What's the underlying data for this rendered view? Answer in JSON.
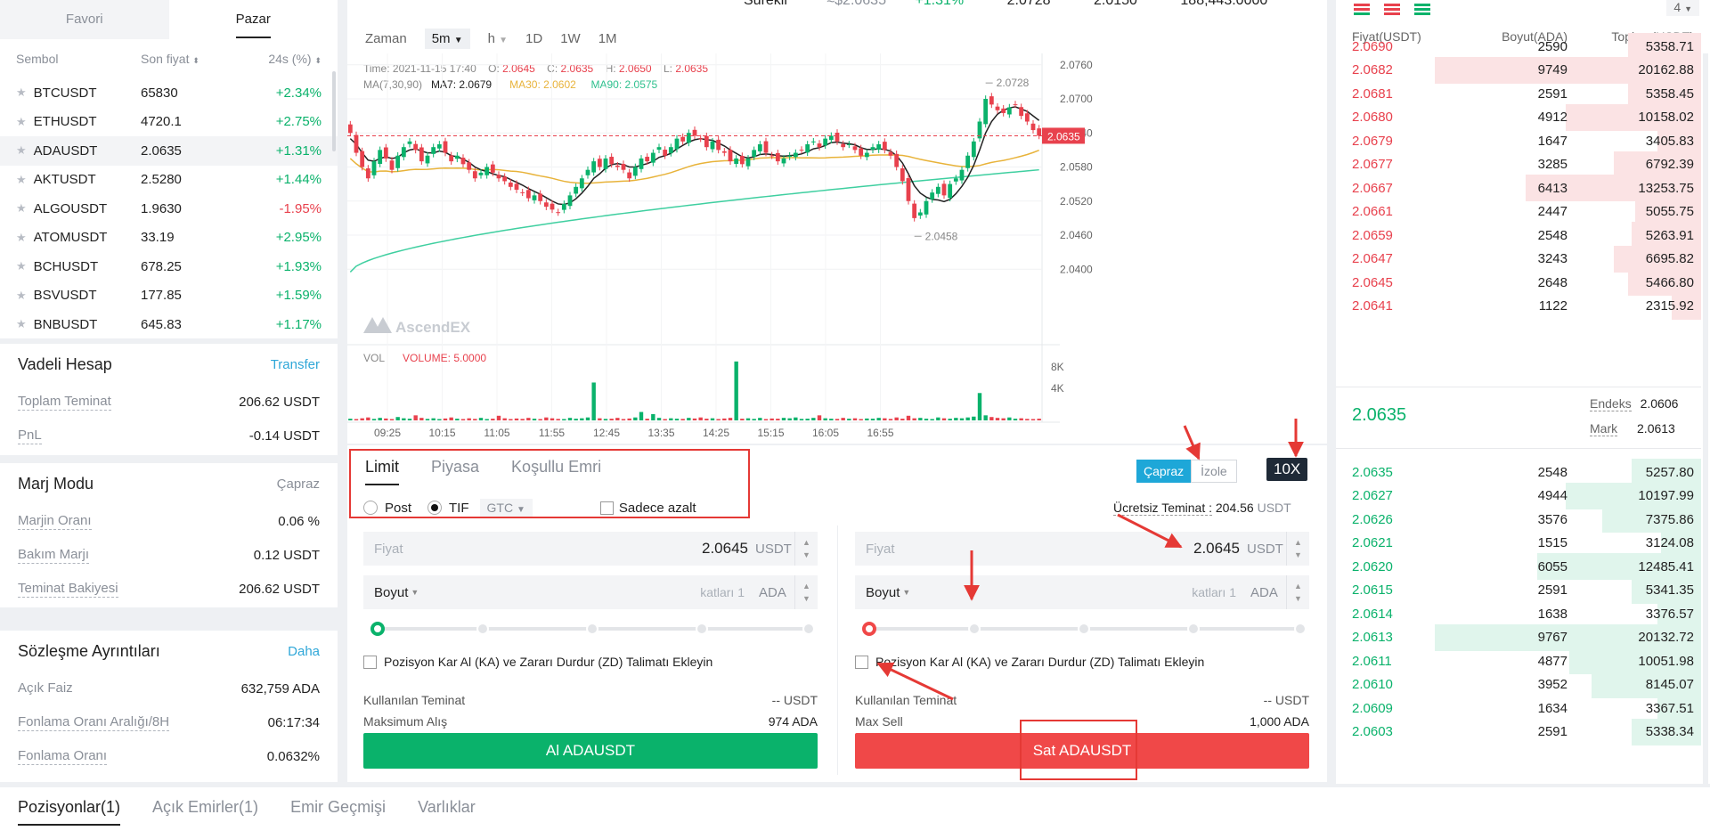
{
  "left": {
    "tabs": [
      "Favori",
      "Pazar"
    ],
    "columns": [
      "Sembol",
      "Son fiyat",
      "24s (%)"
    ],
    "markets": [
      {
        "symbol": "BTCUSDT",
        "price": "65830",
        "change": "+2.34%",
        "dir": "up"
      },
      {
        "symbol": "ETHUSDT",
        "price": "4720.1",
        "change": "+2.75%",
        "dir": "up"
      },
      {
        "symbol": "ADAUSDT",
        "price": "2.0635",
        "change": "+1.31%",
        "dir": "up"
      },
      {
        "symbol": "AKTUSDT",
        "price": "2.5280",
        "change": "+1.44%",
        "dir": "up"
      },
      {
        "symbol": "ALGOUSDT",
        "price": "1.9630",
        "change": "-1.95%",
        "dir": "down"
      },
      {
        "symbol": "ATOMUSDT",
        "price": "33.19",
        "change": "+2.95%",
        "dir": "up"
      },
      {
        "symbol": "BCHUSDT",
        "price": "678.25",
        "change": "+1.93%",
        "dir": "up"
      },
      {
        "symbol": "BSVUSDT",
        "price": "177.85",
        "change": "+1.59%",
        "dir": "up"
      },
      {
        "symbol": "BNBUSDT",
        "price": "645.83",
        "change": "+1.17%",
        "dir": "up"
      }
    ],
    "futures": {
      "title": "Vadeli Hesap",
      "link": "Transfer",
      "rows": [
        {
          "k": "Toplam Teminat",
          "v": "206.62 USDT"
        },
        {
          "k": "PnL",
          "v": "-0.14 USDT"
        }
      ]
    },
    "margin": {
      "title": "Marj Modu",
      "mode": "Çapraz",
      "rows": [
        {
          "k": "Marjin Oranı",
          "v": "0.06 %"
        },
        {
          "k": "Bakım Marjı",
          "v": "0.12 USDT"
        },
        {
          "k": "Teminat Bakiyesi",
          "v": "206.62 USDT"
        }
      ]
    },
    "contract": {
      "title": "Sözleşme Ayrıntıları",
      "link": "Daha",
      "rows": [
        {
          "k": "Açık Faiz",
          "v": "632,759 ADA",
          "dashed": false
        },
        {
          "k": "Fonlama Oranı Aralığı/8H",
          "v": "06:17:34",
          "dashed": true
        },
        {
          "k": "Fonlama Oranı",
          "v": "0.0632%",
          "dashed": true
        }
      ]
    }
  },
  "top_partial": {
    "label": "Sürekli",
    "approx": "≈$2.0635",
    "change": "+1.31%",
    "high": "2.0728",
    "low": "2.0150",
    "volume": "188,443.0000"
  },
  "chart": {
    "timeframes": {
      "label": "Zaman",
      "selected": "5m",
      "hour": "h",
      "items": [
        "1D",
        "1W",
        "1M"
      ]
    },
    "info": {
      "time_label": "Time:",
      "time": "2021-11-15 17:40",
      "o_label": "O:",
      "o": "2.0645",
      "c_label": "C:",
      "c": "2.0635",
      "h_label": "H:",
      "h": "2.0650",
      "l_label": "L:",
      "l": "2.0635"
    },
    "ma": {
      "label": "MA(7,30,90)",
      "ma7": "MA7: 2.0679",
      "ma30": "MA30: 2.0602",
      "ma90": "MA90: 2.0575"
    },
    "colors": {
      "up": "#0ab26b",
      "down": "#e8414d",
      "ma7": "#222222",
      "ma30": "#e8b33a",
      "ma90": "#3fcfa0"
    },
    "watermark": "AscendEX",
    "current_price": "2.0635",
    "max_label": "2.0728",
    "min_label": "2.0458",
    "vol_label": "VOL",
    "vol_value": "VOLUME: 5.0000",
    "vol_ticks": [
      "8K",
      "4K"
    ],
    "chart_data": {
      "type": "candlestick",
      "y_ticks": [
        "2.0760",
        "2.0700",
        "2.0640",
        "2.0580",
        "2.0520",
        "2.0460",
        "2.0400"
      ],
      "ylim": [
        2.038,
        2.078
      ],
      "x_ticks": [
        "09:25",
        "10:15",
        "11:05",
        "11:55",
        "12:45",
        "13:35",
        "14:25",
        "15:15",
        "16:05",
        "16:55"
      ],
      "close": [
        2.064,
        2.0605,
        2.058,
        2.056,
        2.059,
        2.061,
        2.0595,
        2.0575,
        2.06,
        2.0615,
        2.0625,
        2.061,
        2.059,
        2.06,
        2.0615,
        2.062,
        2.0605,
        2.059,
        2.06,
        2.0585,
        2.0575,
        2.056,
        2.057,
        2.058,
        2.057,
        2.056,
        2.0555,
        2.0545,
        2.054,
        2.0535,
        2.0525,
        2.053,
        2.052,
        2.051,
        2.0505,
        2.05,
        2.0515,
        2.053,
        2.0545,
        2.056,
        2.0575,
        2.059,
        2.058,
        2.0595,
        2.0585,
        2.058,
        2.0575,
        2.056,
        2.058,
        2.0595,
        2.059,
        2.0605,
        2.0615,
        2.06,
        2.0615,
        2.063,
        2.0625,
        2.064,
        2.0635,
        2.063,
        2.0615,
        2.0625,
        2.061,
        2.0605,
        2.059,
        2.0595,
        2.0585,
        2.0595,
        2.061,
        2.062,
        2.0605,
        2.06,
        2.059,
        2.0595,
        2.06,
        2.0605,
        2.061,
        2.062,
        2.0625,
        2.0615,
        2.063,
        2.0635,
        2.0625,
        2.0615,
        2.062,
        2.061,
        2.06,
        2.0605,
        2.0615,
        2.062,
        2.061,
        2.06,
        2.058,
        2.0555,
        2.052,
        2.049,
        2.05,
        2.052,
        2.0535,
        2.0545,
        2.053,
        2.055,
        2.056,
        2.0575,
        2.06,
        2.0625,
        2.066,
        2.07,
        2.069,
        2.068,
        2.0675,
        2.0685,
        2.069,
        2.067,
        2.066,
        2.0645,
        2.0635
      ],
      "open_offset_pattern": [
        0.0015,
        -0.0012,
        0.001,
        -0.0008,
        0.0018,
        -0.0015
      ],
      "ma7": [
        2.063,
        2.062,
        2.0605,
        2.0592,
        2.059,
        2.0595,
        2.0598,
        2.0595,
        2.0597,
        2.0605,
        2.061,
        2.0612,
        2.0608,
        2.0605,
        2.0605,
        2.0608,
        2.0606,
        2.06,
        2.0598,
        2.0594,
        2.0588,
        2.058,
        2.0575,
        2.0572,
        2.0568,
        2.0565,
        2.0563,
        2.0558,
        2.0553,
        2.0548,
        2.0542,
        2.0537,
        2.0532,
        2.0526,
        2.052,
        2.0515,
        2.0514,
        2.0517,
        2.0524,
        2.0534,
        2.0546,
        2.056,
        2.0568,
        2.0578,
        2.0584,
        2.0586,
        2.0584,
        2.058,
        2.058,
        2.0583,
        2.0586,
        2.059,
        2.0597,
        2.06,
        2.0604,
        2.0612,
        2.0618,
        2.0624,
        2.0628,
        2.063,
        2.0628,
        2.0627,
        2.0622,
        2.0617,
        2.061,
        2.0604,
        2.0598,
        2.0596,
        2.0598,
        2.0602,
        2.0603,
        2.0602,
        2.06,
        2.0599,
        2.06,
        2.0601,
        2.0603,
        2.0607,
        2.0612,
        2.0614,
        2.0618,
        2.0623,
        2.0624,
        2.0622,
        2.0621,
        2.0619,
        2.0614,
        2.0611,
        2.0611,
        2.0612,
        2.0611,
        2.0608,
        2.06,
        2.0587,
        2.0568,
        2.0547,
        2.0534,
        2.0527,
        2.0523,
        2.0522,
        2.0519,
        2.0523,
        2.0533,
        2.0546,
        2.0562,
        2.0583,
        2.061,
        2.064,
        2.066,
        2.0673,
        2.068,
        2.0684,
        2.0686,
        2.0682,
        2.0678,
        2.067,
        2.0662
      ],
      "ma30_start": 2.054,
      "ma30_end": 2.0602,
      "ma90_start": 2.0395,
      "ma90_end": 2.0575,
      "volume": [
        400,
        300,
        500,
        700,
        350,
        600,
        450,
        300,
        800,
        500,
        400,
        1200,
        600,
        350,
        500,
        300,
        450,
        700,
        400,
        300,
        500,
        350,
        600,
        300,
        400,
        1100,
        500,
        300,
        450,
        350,
        600,
        400,
        300,
        700,
        500,
        350,
        300,
        600,
        400,
        500,
        700,
        9000,
        500,
        350,
        400,
        600,
        300,
        450,
        700,
        2000,
        400,
        1500,
        600,
        300,
        500,
        400,
        350,
        600,
        450,
        700,
        400,
        500,
        300,
        450,
        600,
        14000,
        400,
        500,
        350,
        600,
        300,
        450,
        400,
        600,
        500,
        700,
        350,
        400,
        600,
        1200,
        500,
        400,
        350,
        600,
        400,
        500,
        300,
        450,
        400,
        600,
        500,
        350,
        700,
        400,
        1100,
        500,
        600,
        400,
        300,
        700,
        500,
        400,
        600,
        500,
        700,
        900,
        6500,
        1200,
        800,
        600,
        500,
        700,
        400,
        500,
        350,
        300,
        400
      ],
      "current": 2.0635,
      "high": 2.0728,
      "low": 2.0458
    }
  },
  "order": {
    "tabs": [
      "Limit",
      "Piyasa",
      "Koşullu Emri"
    ],
    "margin_modes": [
      "Çapraz",
      "İzole"
    ],
    "leverage": "10X",
    "post": "Post",
    "tif": "TIF",
    "gtc": "GTC",
    "reduce_only": "Sadece azalt",
    "free_margin_label": "Ücretsiz Teminat :",
    "free_margin_value": "204.56",
    "free_margin_unit": "USDT",
    "buy": {
      "price_ph": "Fiyat",
      "price": "2.0645",
      "unit": "USDT",
      "size_label": "Boyut",
      "size_ph": "katları 1",
      "size_unit": "ADA",
      "tpsl": "Pozisyon Kar Al (KA) ve Zararı Durdur (ZD) Talimatı Ekleyin",
      "used_label": "Kullanılan Teminat",
      "used_value": "-- USDT",
      "max_label": "Maksimum Alış",
      "max_value": "974 ADA",
      "button": "Al ADAUSDT",
      "color": "#0ab26b"
    },
    "sell": {
      "price_ph": "Fiyat",
      "price": "2.0645",
      "unit": "USDT",
      "size_label": "Boyut",
      "size_ph": "katları 1",
      "size_unit": "ADA",
      "tpsl": "Pozisyon Kar Al (KA) ve Zararı Durdur (ZD) Talimatı Ekleyin",
      "used_label": "Kullanılan Teminat",
      "used_value": "-- USDT",
      "max_label": "Max Sell",
      "max_value": "1,000 ADA",
      "button": "Sat ADAUSDT",
      "color": "#f04848"
    }
  },
  "book": {
    "depth": "4",
    "columns": [
      "Fiyat(USDT)",
      "Boyut(ADA)",
      "Toplam(USDT)"
    ],
    "asks": [
      {
        "p": "2.0690",
        "s": "2590",
        "t": "5358.71",
        "fill": 0.2
      },
      {
        "p": "2.0682",
        "s": "9749",
        "t": "20162.88",
        "fill": 0.73
      },
      {
        "p": "2.0681",
        "s": "2591",
        "t": "5358.45",
        "fill": 0.2
      },
      {
        "p": "2.0680",
        "s": "4912",
        "t": "10158.02",
        "fill": 0.37
      },
      {
        "p": "2.0679",
        "s": "1647",
        "t": "3405.83",
        "fill": 0.12
      },
      {
        "p": "2.0677",
        "s": "3285",
        "t": "6792.39",
        "fill": 0.24
      },
      {
        "p": "2.0667",
        "s": "6413",
        "t": "13253.75",
        "fill": 0.48
      },
      {
        "p": "2.0661",
        "s": "2447",
        "t": "5055.75",
        "fill": 0.18
      },
      {
        "p": "2.0659",
        "s": "2548",
        "t": "5263.91",
        "fill": 0.19
      },
      {
        "p": "2.0647",
        "s": "3243",
        "t": "6695.82",
        "fill": 0.24
      },
      {
        "p": "2.0645",
        "s": "2648",
        "t": "5466.80",
        "fill": 0.2
      },
      {
        "p": "2.0641",
        "s": "1122",
        "t": "2315.92",
        "fill": 0.08
      }
    ],
    "last": "2.0635",
    "index_label": "Endeks",
    "index": "2.0606",
    "mark_label": "Mark",
    "mark": "2.0613",
    "bids": [
      {
        "p": "2.0635",
        "s": "2548",
        "t": "5257.80",
        "fill": 0.19
      },
      {
        "p": "2.0627",
        "s": "4944",
        "t": "10197.99",
        "fill": 0.37
      },
      {
        "p": "2.0626",
        "s": "3576",
        "t": "7375.86",
        "fill": 0.27
      },
      {
        "p": "2.0621",
        "s": "1515",
        "t": "3124.08",
        "fill": 0.11
      },
      {
        "p": "2.0620",
        "s": "6055",
        "t": "12485.41",
        "fill": 0.45
      },
      {
        "p": "2.0615",
        "s": "2591",
        "t": "5341.35",
        "fill": 0.19
      },
      {
        "p": "2.0614",
        "s": "1638",
        "t": "3376.57",
        "fill": 0.12
      },
      {
        "p": "2.0613",
        "s": "9767",
        "t": "20132.72",
        "fill": 0.73
      },
      {
        "p": "2.0611",
        "s": "4877",
        "t": "10051.98",
        "fill": 0.36
      },
      {
        "p": "2.0610",
        "s": "3952",
        "t": "8145.07",
        "fill": 0.3
      },
      {
        "p": "2.0609",
        "s": "1634",
        "t": "3367.51",
        "fill": 0.12
      },
      {
        "p": "2.0603",
        "s": "2591",
        "t": "5338.34",
        "fill": 0.19
      }
    ]
  },
  "bottom_tabs": [
    "Pozisyonlar(1)",
    "Açık Emirler(1)",
    "Emir Geçmişi",
    "Varlıklar"
  ]
}
